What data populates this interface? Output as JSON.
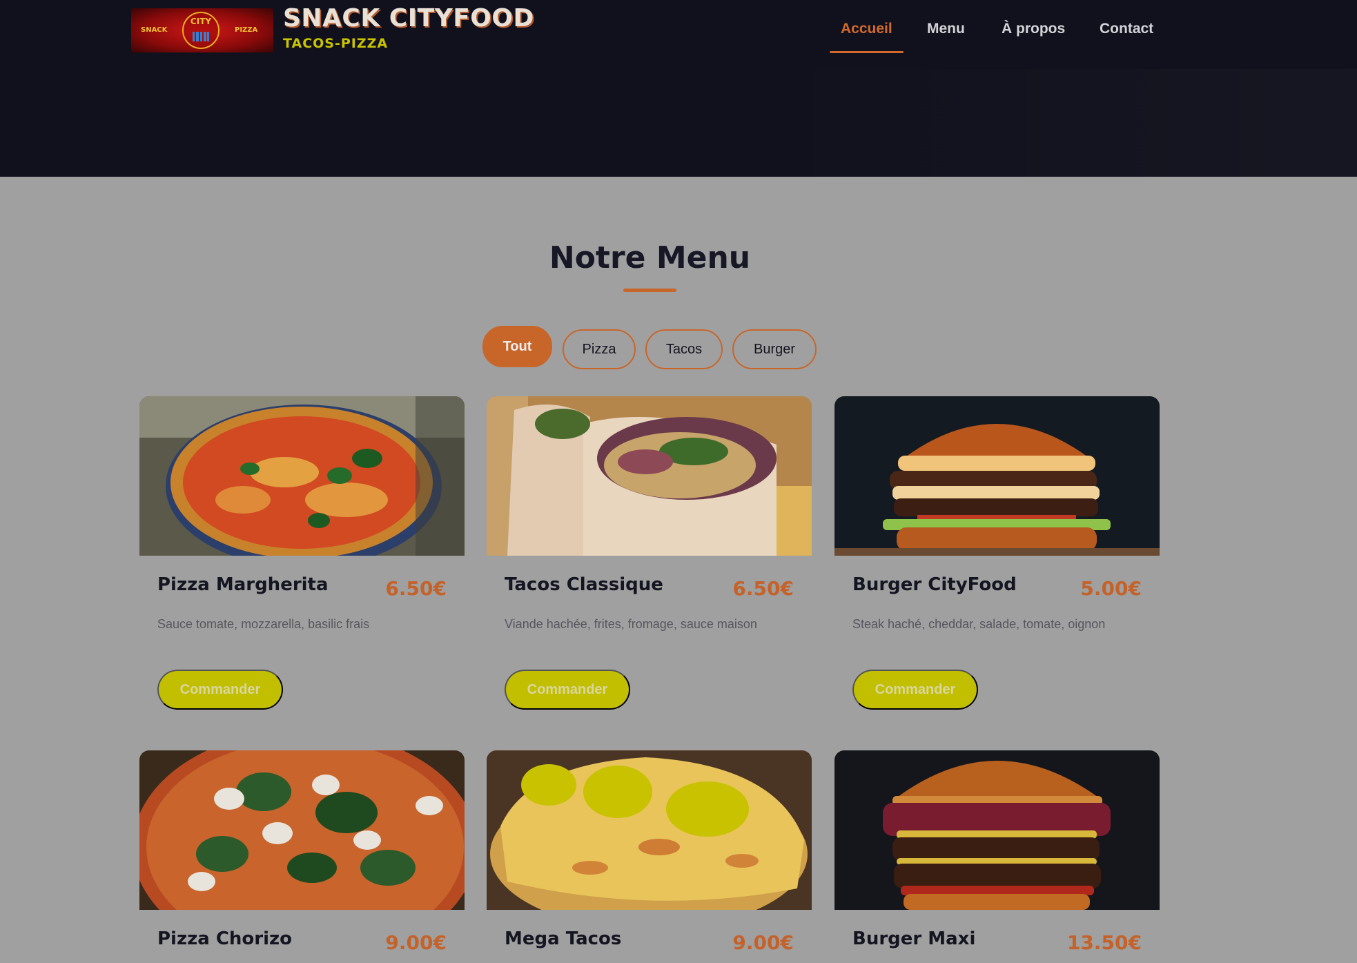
{
  "brand": {
    "badge_left": "SNACK",
    "badge_center": "CITY",
    "badge_right": "PIZZA",
    "title": "SNACK CITYFOOD",
    "subtitle": "TACOS-PIZZA"
  },
  "nav": {
    "items": [
      {
        "label": "Accueil",
        "active": true
      },
      {
        "label": "Menu",
        "active": false
      },
      {
        "label": "À propos",
        "active": false
      },
      {
        "label": "Contact",
        "active": false
      }
    ]
  },
  "menu": {
    "title": "Notre Menu",
    "filters": [
      {
        "label": "Tout",
        "active": true
      },
      {
        "label": "Pizza",
        "active": false
      },
      {
        "label": "Tacos",
        "active": false
      },
      {
        "label": "Burger",
        "active": false
      }
    ],
    "items": [
      {
        "name": "Pizza Margherita",
        "price": "6.50€",
        "description": "Sauce tomate, mozzarella, basilic frais",
        "button": "Commander",
        "image": "pizza-margherita-photo"
      },
      {
        "name": "Tacos Classique",
        "price": "6.50€",
        "description": "Viande hachée, frites, fromage, sauce maison",
        "button": "Commander",
        "image": "tacos-classique-photo"
      },
      {
        "name": "Burger CityFood",
        "price": "5.00€",
        "description": "Steak haché, cheddar, salade, tomate, oignon",
        "button": "Commander",
        "image": "burger-cityfood-photo"
      },
      {
        "name": "Pizza Chorizo",
        "price": "9.00€",
        "image": "pizza-chorizo-photo"
      },
      {
        "name": "Mega Tacos",
        "price": "9.00€",
        "image": "mega-tacos-photo"
      },
      {
        "name": "Burger Maxi",
        "price": "13.50€",
        "image": "burger-maxi-photo"
      }
    ]
  },
  "colors": {
    "header_bg": "#11111d",
    "page_bg": "#a0a0a0",
    "accent_orange": "#c8662a",
    "accent_yellow": "#c2bf00",
    "title_text": "#171726"
  }
}
